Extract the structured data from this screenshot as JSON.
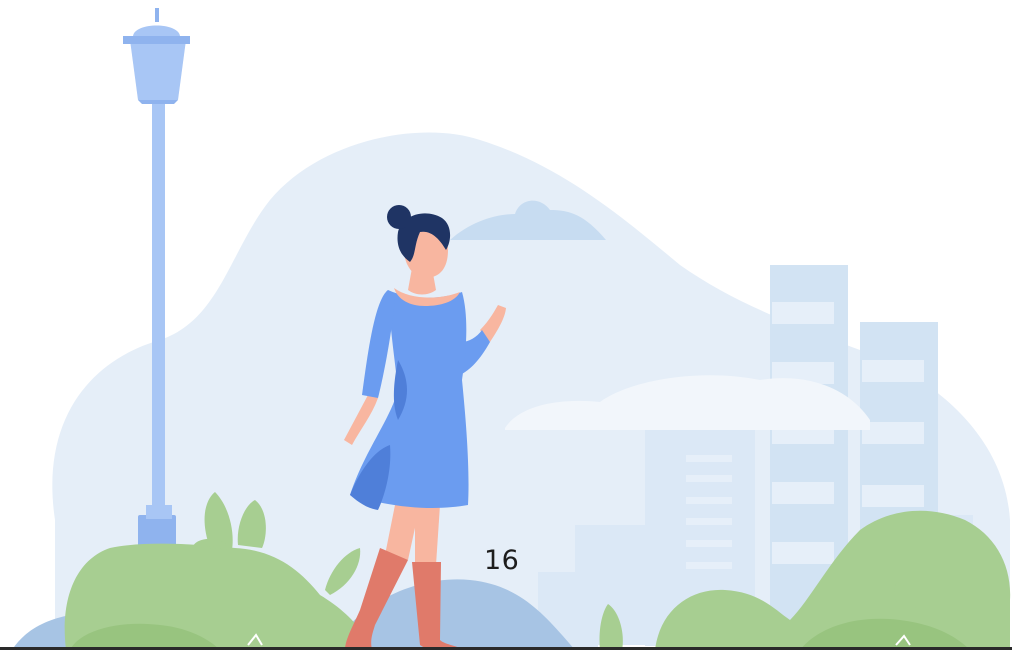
{
  "page": {
    "number": "16"
  },
  "scene": {
    "colors": {
      "background_blob": "#e5eef8",
      "cloud": "#f2f6fb",
      "cloud_dark": "#c7dcf1",
      "building_light": "#dbe8f6",
      "building_mid": "#d2e3f3",
      "building_window": "#e6eff9",
      "lamp": "#a8c6f5",
      "lamp_dark": "#8fb3ee",
      "bush_green": "#a7ce91",
      "bush_green_dark": "#98c47f",
      "hill_blue": "#a7c4e4",
      "dress_blue": "#6b9cf0",
      "dress_shadow": "#4f7fd9",
      "skin": "#f8b6a0",
      "hair": "#1f3464",
      "boots": "#e07a6a",
      "ground_line": "#2a2a2a"
    },
    "elements": [
      "street-lamp",
      "woman-walking",
      "city-buildings",
      "bushes",
      "cloud",
      "background-blob"
    ]
  }
}
